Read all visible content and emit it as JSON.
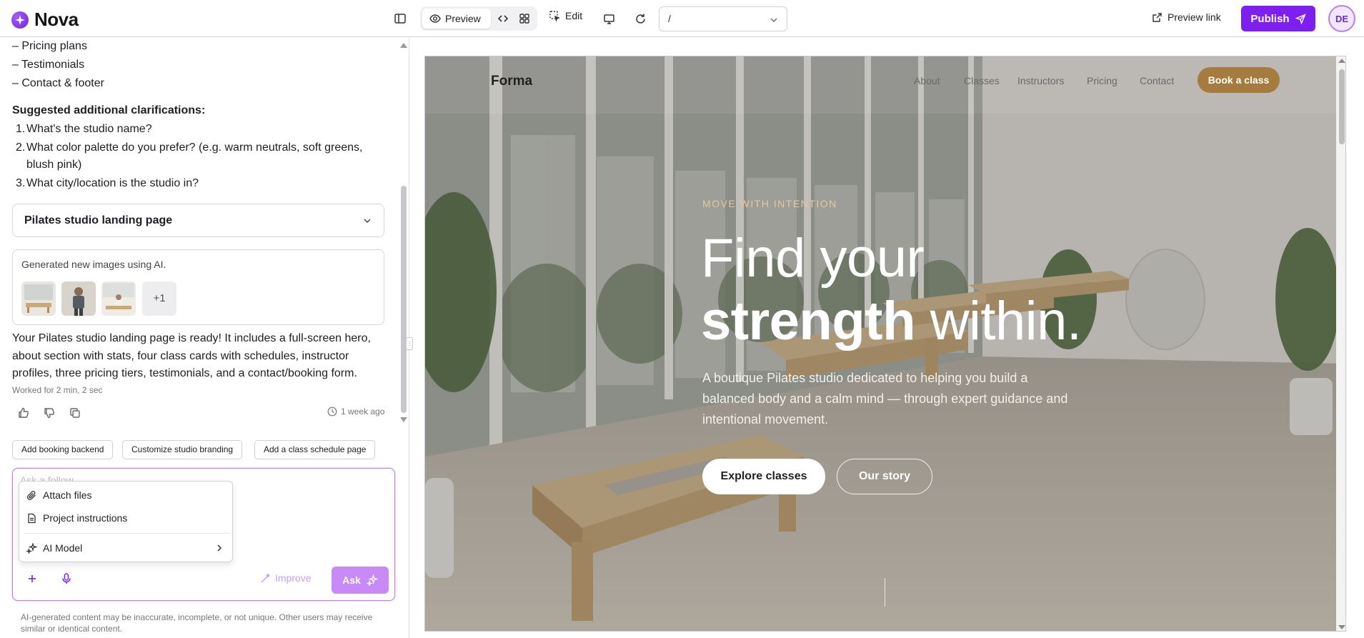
{
  "app": {
    "name": "Nova"
  },
  "toolbar": {
    "preview_label": "Preview",
    "edit_label": "Edit",
    "route_value": "/",
    "preview_link_label": "Preview link",
    "publish_label": "Publish",
    "avatar_initials": "DE",
    "accent_color": "#7c1ff0"
  },
  "chat": {
    "list_lines": [
      "– Pricing plans",
      "– Testimonials",
      "– Contact & footer"
    ],
    "clarifications_heading": "Suggested additional clarifications:",
    "clarifications": [
      {
        "n": "1.",
        "text": "What's the studio name?"
      },
      {
        "n": "2.",
        "text": "What color palette do you prefer? (e.g. warm neutrals, soft greens, blush pink)"
      },
      {
        "n": "3.",
        "text": "What city/location is the studio in?"
      }
    ],
    "accordion_title": "Pilates studio landing page",
    "generated_title": "Generated new images using AI.",
    "generated_more": "+1",
    "summary": "Your Pilates studio landing page is ready! It includes a full-screen hero, about section with stats, four class cards with schedules, instructor profiles, three pricing tiers, testimonials, and a contact/booking form.",
    "worked": "Worked for 2 min, 2 sec",
    "time_ago": "1 week ago",
    "suggestions": [
      "Add booking backend",
      "Customize studio branding",
      "Add a class schedule page"
    ],
    "composer_placeholder": "Ask a follow...",
    "menu": {
      "attach": "Attach files",
      "instructions": "Project instructions",
      "model": "AI Model"
    },
    "improve_label": "Improve",
    "ask_label": "Ask",
    "disclaimer": "AI-generated content may be inaccurate, incomplete, or not unique. Other users may receive similar or identical content."
  },
  "site": {
    "brand": "Forma",
    "nav": [
      "About",
      "Classes",
      "Instructors",
      "Pricing",
      "Contact"
    ],
    "cta": "Book a class",
    "eyebrow": "MOVE WITH INTENTION",
    "headline_line1": "Find your",
    "headline_bold": "strength",
    "headline_rest": " within.",
    "subtext": "A boutique Pilates studio dedicated to helping you build a balanced body and a calm mind — through expert guidance and intentional movement.",
    "primary_button": "Explore classes",
    "secondary_button": "Our story",
    "accent_color": "#a57c3d"
  }
}
